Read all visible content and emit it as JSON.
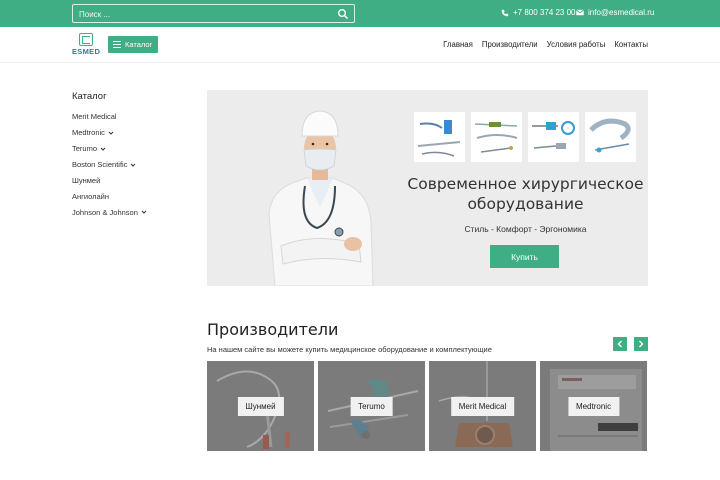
{
  "topbar": {
    "search_placeholder": "Поиск ...",
    "phone": "+7 800 374 23 00",
    "email": "info@esmedical.ru"
  },
  "header": {
    "logo_text": "ESMED",
    "catalog_button": "Каталог",
    "nav": [
      "Главная",
      "Производители",
      "Условия работы",
      "Контакты"
    ]
  },
  "sidebar": {
    "title": "Каталог",
    "items": [
      {
        "label": "Merit Medical",
        "has_submenu": false
      },
      {
        "label": "Medtronic",
        "has_submenu": true
      },
      {
        "label": "Terumo",
        "has_submenu": true
      },
      {
        "label": "Boston Scientific",
        "has_submenu": true
      },
      {
        "label": "Шунмей",
        "has_submenu": false
      },
      {
        "label": "Ангиолайн",
        "has_submenu": false
      },
      {
        "label": "Johnson & Johnson",
        "has_submenu": true
      }
    ]
  },
  "banner": {
    "title_line1": "Современное хирургическое",
    "title_line2": "оборудование",
    "subtitle": "Стиль - Комфорт - Эргономика",
    "button": "Купить"
  },
  "manufacturers": {
    "title": "Производители",
    "subtitle": "На нашем сайте вы можете купить медицинское оборудование и комплектующие",
    "cards": [
      "Шунмей",
      "Terumo",
      "Merit Medical",
      "Medtronic"
    ]
  },
  "colors": {
    "accent": "#3fae85",
    "logo_blue": "#2d7e99",
    "banner_bg": "#ececec",
    "card_overlay": "#7b7b7b"
  }
}
